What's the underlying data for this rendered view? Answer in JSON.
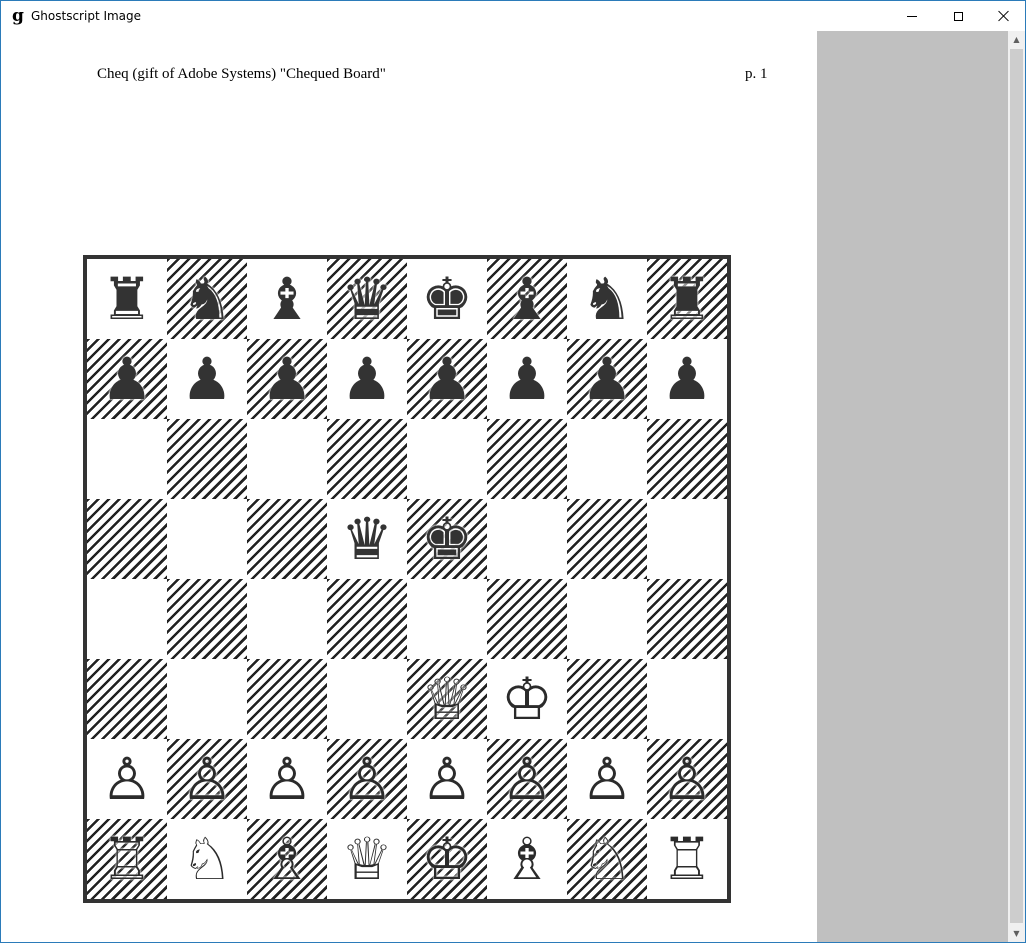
{
  "window": {
    "title": "Ghostscript Image",
    "app_icon": "g",
    "controls": {
      "minimize": "minimize",
      "maximize": "maximize",
      "close": "close"
    }
  },
  "document": {
    "title": "Cheq (gift of Adobe Systems) \"Chequed Board\"",
    "page_number": "p. 1"
  },
  "board": {
    "light_square_color": "#ffffff",
    "dark_square_style": "diagonal-hatch",
    "rows": [
      [
        "♜",
        "♞",
        "♝",
        "♛",
        "♚",
        "♝",
        "♞",
        "♜"
      ],
      [
        "♟",
        "♟",
        "♟",
        "♟",
        "♟",
        "♟",
        "♟",
        "♟"
      ],
      [
        "",
        "",
        "",
        "",
        "",
        "",
        "",
        ""
      ],
      [
        "",
        "",
        "",
        "♛",
        "♚",
        "",
        "",
        ""
      ],
      [
        "",
        "",
        "",
        "",
        "",
        "",
        "",
        ""
      ],
      [
        "",
        "",
        "",
        "",
        "♕",
        "♔",
        "",
        ""
      ],
      [
        "♙",
        "♙",
        "♙",
        "♙",
        "♙",
        "♙",
        "♙",
        "♙"
      ],
      [
        "♖",
        "♘",
        "♗",
        "♕",
        "♔",
        "♗",
        "♘",
        "♖"
      ]
    ]
  }
}
